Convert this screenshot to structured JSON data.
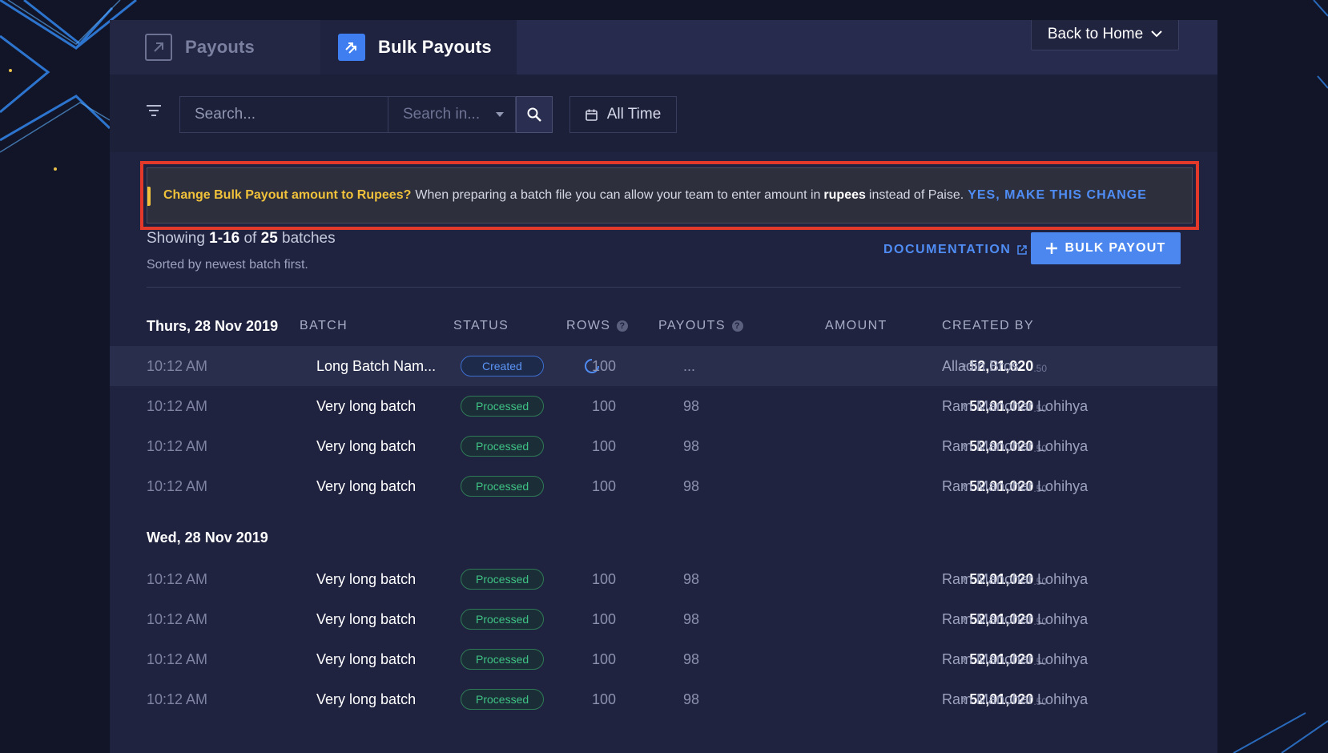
{
  "tabs": [
    {
      "label": "Payouts"
    },
    {
      "label": "Bulk Payouts"
    }
  ],
  "back_button": {
    "label": "Back to Home"
  },
  "search": {
    "placeholder": "Search...",
    "search_in_placeholder": "Search in..."
  },
  "date_filter": {
    "label": "All Time"
  },
  "notice": {
    "title": "Change Bulk Payout amount to Rupees?",
    "text_before": "When preparing a batch file you can allow your team to enter amount in",
    "emphasis": "rupees",
    "text_after": "instead of Paise.",
    "cta": "YES, MAKE THIS CHANGE"
  },
  "summary": {
    "prefix": "Showing",
    "range": "1-16",
    "of": "of",
    "total": "25",
    "suffix": "batches",
    "sorted": "Sorted by newest batch first."
  },
  "actions": {
    "documentation": "DOCUMENTATION",
    "bulk_payout": "BULK PAYOUT"
  },
  "columns": {
    "batch": "BATCH",
    "status": "STATUS",
    "rows": "ROWS",
    "payouts": "PAYOUTS",
    "amount": "AMOUNT",
    "created_by": "CREATED BY"
  },
  "groups": [
    {
      "date": "Thurs, 28 Nov 2019",
      "rows": [
        {
          "time": "10:12 AM",
          "batch": "Long Batch Nam...",
          "status": "Created",
          "rows": "100",
          "payouts": "...",
          "currency": "₹",
          "amount": "52,01,020",
          "decimals": ".50",
          "created_by": "Alladin Bros"
        },
        {
          "time": "10:12 AM",
          "batch": "Very long batch",
          "status": "Processed",
          "rows": "100",
          "payouts": "98",
          "currency": "₹",
          "amount": "52,01,020",
          "decimals": ".50",
          "created_by": "Ram Manohar Lohihya"
        },
        {
          "time": "10:12 AM",
          "batch": "Very long batch",
          "status": "Processed",
          "rows": "100",
          "payouts": "98",
          "currency": "₹",
          "amount": "52,01,020",
          "decimals": ".50",
          "created_by": "Ram Manohar Lohihya"
        },
        {
          "time": "10:12 AM",
          "batch": "Very long batch",
          "status": "Processed",
          "rows": "100",
          "payouts": "98",
          "currency": "₹",
          "amount": "52,01,020",
          "decimals": ".50",
          "created_by": "Ram Manohar Lohihya"
        }
      ]
    },
    {
      "date": "Wed, 28 Nov 2019",
      "rows": [
        {
          "time": "10:12 AM",
          "batch": "Very long batch",
          "status": "Processed",
          "rows": "100",
          "payouts": "98",
          "currency": "₹",
          "amount": "52,01,020",
          "decimals": ".50",
          "created_by": "Ram Manohar Lohihya"
        },
        {
          "time": "10:12 AM",
          "batch": "Very long batch",
          "status": "Processed",
          "rows": "100",
          "payouts": "98",
          "currency": "₹",
          "amount": "52,01,020",
          "decimals": ".50",
          "created_by": "Ram Manohar Lohihya"
        },
        {
          "time": "10:12 AM",
          "batch": "Very long batch",
          "status": "Processed",
          "rows": "100",
          "payouts": "98",
          "currency": "₹",
          "amount": "52,01,020",
          "decimals": ".50",
          "created_by": "Ram Manohar Lohihya"
        },
        {
          "time": "10:12 AM",
          "batch": "Very long batch",
          "status": "Processed",
          "rows": "100",
          "payouts": "98",
          "currency": "₹",
          "amount": "52,01,020",
          "decimals": ".50",
          "created_by": "Ram Manohar Lohihya"
        }
      ]
    }
  ],
  "colors": {
    "accent": "#4b87ef",
    "warning": "#f0c13a",
    "success": "#3fc486",
    "highlight_border": "#e2392b"
  }
}
